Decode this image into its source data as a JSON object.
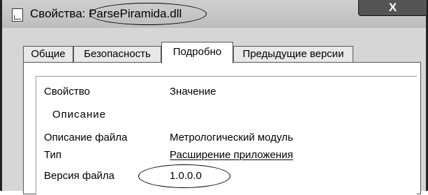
{
  "window": {
    "title": "Свойства: ParsePiramida.dll",
    "close_glyph": "X"
  },
  "tabs": [
    {
      "label": "Общие",
      "active": false
    },
    {
      "label": "Безопасность",
      "active": false
    },
    {
      "label": "Подробно",
      "active": true
    },
    {
      "label": "Предыдущие версии",
      "active": false
    }
  ],
  "details": {
    "header_property": "Свойство",
    "header_value": "Значение",
    "section": "Описание",
    "rows": [
      {
        "property": "Описание файла",
        "value": "Метрологический модуль"
      },
      {
        "property": "Тип",
        "value": "Расширение приложения"
      },
      {
        "property": "Версия файла",
        "value": "1.0.0.0"
      }
    ]
  }
}
